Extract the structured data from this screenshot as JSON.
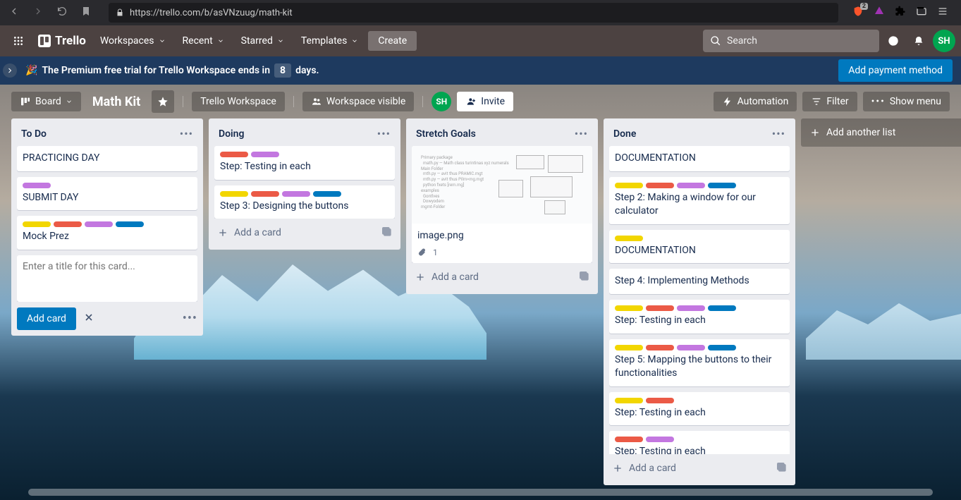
{
  "browser": {
    "url": "https://trello.com/b/asVNzuug/math-kit",
    "shield_count": "2"
  },
  "header": {
    "logo": "Trello",
    "nav": [
      "Workspaces",
      "Recent",
      "Starred",
      "Templates"
    ],
    "create": "Create",
    "search_placeholder": "Search",
    "avatar": "SH"
  },
  "banner": {
    "text_pre": "The Premium free trial for Trello Workspace ends in",
    "days": "8",
    "text_post": "days.",
    "cta": "Add payment method"
  },
  "board_header": {
    "board_btn": "Board",
    "title": "Math Kit",
    "workspace": "Trello Workspace",
    "visibility": "Workspace visible",
    "invite": "Invite",
    "avatar": "SH",
    "automation": "Automation",
    "filter": "Filter",
    "show_menu": "Show menu"
  },
  "lists": [
    {
      "title": "To Do",
      "cards": [
        {
          "labels": [],
          "title": "PRACTICING DAY"
        },
        {
          "labels": [
            "purple"
          ],
          "title": "SUBMIT DAY"
        },
        {
          "labels": [
            "yellow",
            "red",
            "purple",
            "blue"
          ],
          "title": "Mock Prez"
        }
      ],
      "compose": {
        "placeholder": "Enter a title for this card...",
        "add_btn": "Add card"
      }
    },
    {
      "title": "Doing",
      "cards": [
        {
          "labels": [
            "red",
            "purple"
          ],
          "title": "Step: Testing in each"
        },
        {
          "labels": [
            "yellow",
            "red",
            "purple",
            "blue"
          ],
          "title": "Step 3: Designing the buttons"
        }
      ],
      "add_label": "Add a card"
    },
    {
      "title": "Stretch Goals",
      "cards": [
        {
          "cover": true,
          "title": "image.png",
          "attachments": "1"
        }
      ],
      "add_label": "Add a card"
    },
    {
      "title": "Done",
      "cards": [
        {
          "labels": [],
          "title": "DOCUMENTATION"
        },
        {
          "labels": [
            "yellow",
            "red",
            "purple",
            "blue"
          ],
          "title": "Step 2: Making a window for our calculator"
        },
        {
          "labels": [
            "yellow"
          ],
          "title": "DOCUMENTATION"
        },
        {
          "labels": [],
          "title": "Step 4: Implementing Methods"
        },
        {
          "labels": [
            "yellow",
            "red",
            "purple",
            "blue"
          ],
          "title": "Step: Testing in each"
        },
        {
          "labels": [
            "yellow",
            "red",
            "purple",
            "blue"
          ],
          "title": "Step 5: Mapping the buttons to their functionalities"
        },
        {
          "labels": [
            "yellow",
            "red"
          ],
          "title": "Step: Testing in each"
        },
        {
          "labels": [
            "red",
            "purple"
          ],
          "title": "Step: Testing in each"
        }
      ],
      "add_label": "Add a card"
    }
  ],
  "add_list": "Add another list"
}
